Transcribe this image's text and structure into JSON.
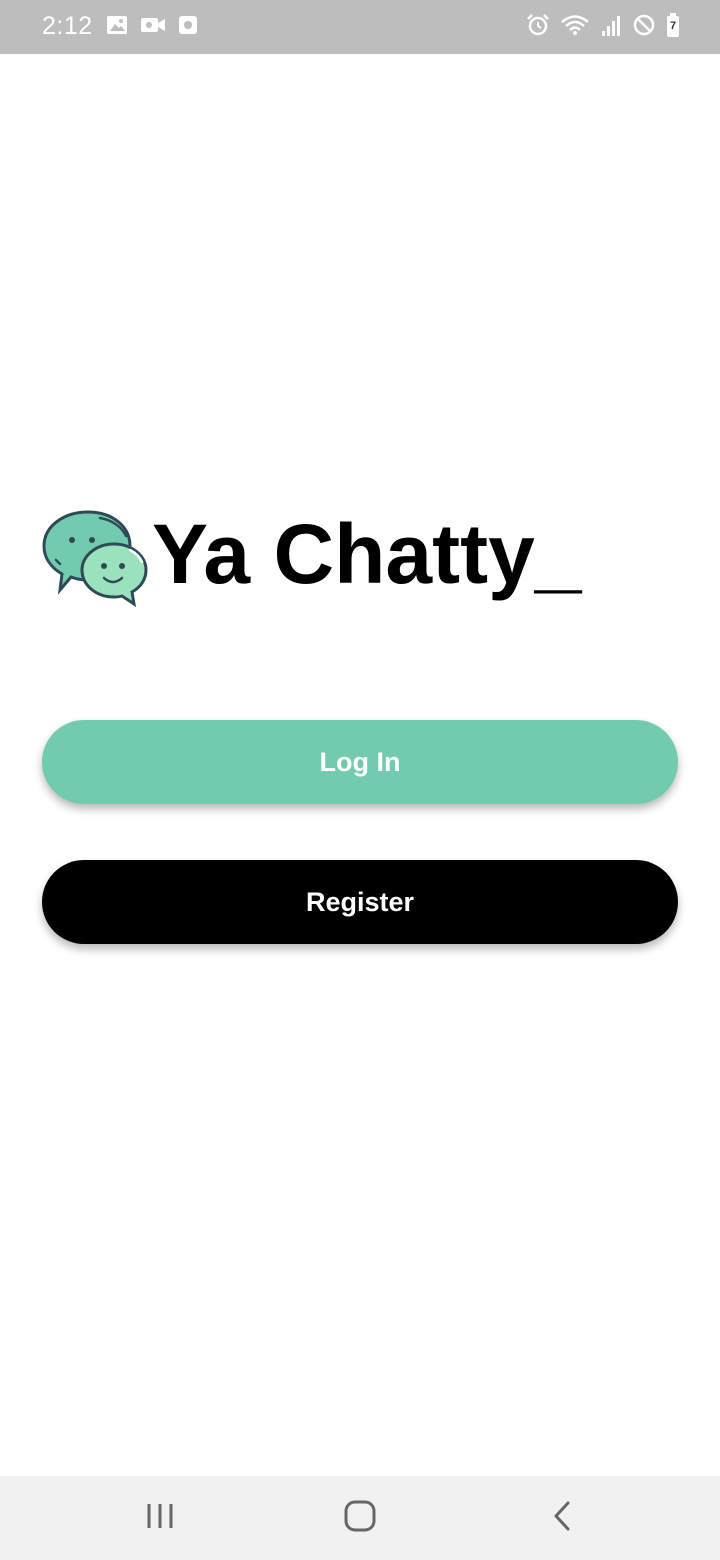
{
  "status_bar": {
    "time": "2:12",
    "left_icons": [
      "image-icon",
      "video-camera-icon",
      "media-icon"
    ],
    "right_icons": [
      "alarm-icon",
      "wifi-icon",
      "signal-icon",
      "do-not-disturb-icon",
      "battery-icon"
    ],
    "battery_label": "7",
    "background": "#bdbdbd"
  },
  "app": {
    "logo_icon": "chat-bubbles-icon",
    "title": "Ya Chatty_"
  },
  "buttons": {
    "login_label": "Log In",
    "register_label": "Register"
  },
  "colors": {
    "accent": "#72cbae",
    "register_bg": "#000000",
    "logo_dark": "#2f4a55",
    "logo_light": "#9ae2be"
  },
  "nav_bar": {
    "icons": [
      "recents-icon",
      "home-icon",
      "back-icon"
    ]
  }
}
